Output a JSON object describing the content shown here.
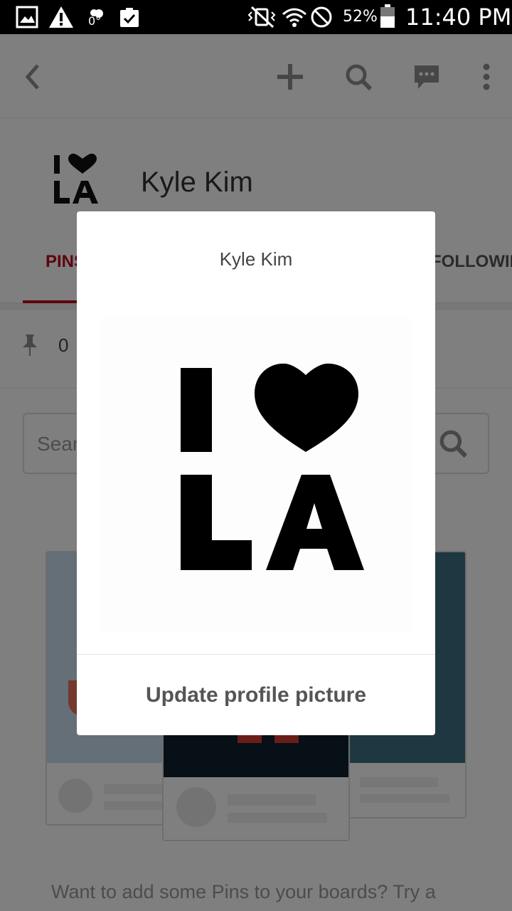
{
  "status_bar": {
    "battery": "52%",
    "time": "11:40 PM",
    "temperature": "0°",
    "icons": [
      "gallery-icon",
      "warning-icon",
      "weather-icon",
      "clipboard-check-icon",
      "vibrate-mute-icon",
      "wifi-icon",
      "block-icon",
      "battery-icon"
    ]
  },
  "toolbar": {
    "icons": [
      "back-icon",
      "plus-icon",
      "search-icon",
      "message-icon",
      "more-vert-icon"
    ]
  },
  "profile": {
    "name": "Kyle Kim",
    "avatar_logo": "I ♥ LA"
  },
  "tabs": {
    "pins": "PINS",
    "following": "FOLLOWING"
  },
  "stats": {
    "pin_count": "0"
  },
  "search": {
    "placeholder": "Search"
  },
  "promo": {
    "text": "Want to add some Pins to your boards? Try a"
  },
  "dialog": {
    "title": "Kyle Kim",
    "action": "Update profile picture"
  },
  "colors": {
    "accent": "#bd081c",
    "icon_gray": "#8e8e8e"
  }
}
